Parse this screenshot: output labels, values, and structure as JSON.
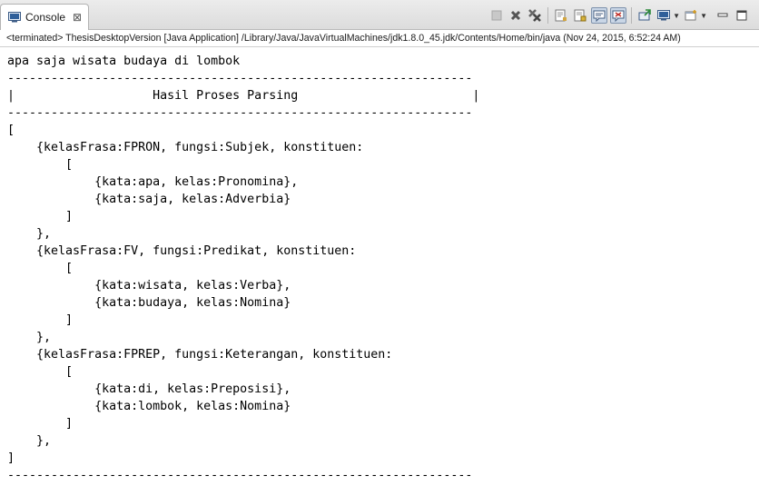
{
  "tab": {
    "label": "Console",
    "icon": "console-icon",
    "close_glyph": "⊠"
  },
  "toolbar": {
    "buttons": [
      "terminate-icon",
      "remove-launch-icon",
      "remove-all-terminated-icon",
      "clear-console-icon",
      "scroll-lock-icon",
      "show-on-stdout-icon",
      "show-on-stderr-icon",
      "pin-console-icon",
      "display-selected-console-icon",
      "open-console-icon",
      "minimize-icon",
      "maximize-icon"
    ]
  },
  "status": {
    "text": "<terminated> ThesisDesktopVersion [Java Application] /Library/Java/JavaVirtualMachines/jdk1.8.0_45.jdk/Contents/Home/bin/java (Nov 24, 2015, 6:52:24 AM)"
  },
  "console": {
    "lines": [
      "apa saja wisata budaya di lombok",
      "----------------------------------------------------------------",
      "|                   Hasil Proses Parsing                        |",
      "----------------------------------------------------------------",
      "[",
      "    {kelasFrasa:FPRON, fungsi:Subjek, konstituen:",
      "        [",
      "            {kata:apa, kelas:Pronomina},",
      "            {kata:saja, kelas:Adverbia}",
      "        ]",
      "    },",
      "    {kelasFrasa:FV, fungsi:Predikat, konstituen:",
      "        [",
      "            {kata:wisata, kelas:Verba},",
      "            {kata:budaya, kelas:Nomina}",
      "        ]",
      "    },",
      "    {kelasFrasa:FPREP, fungsi:Keterangan, konstituen:",
      "        [",
      "            {kata:di, kelas:Preposisi},",
      "            {kata:lombok, kelas:Nomina}",
      "        ]",
      "    },",
      "]",
      "----------------------------------------------------------------"
    ]
  }
}
